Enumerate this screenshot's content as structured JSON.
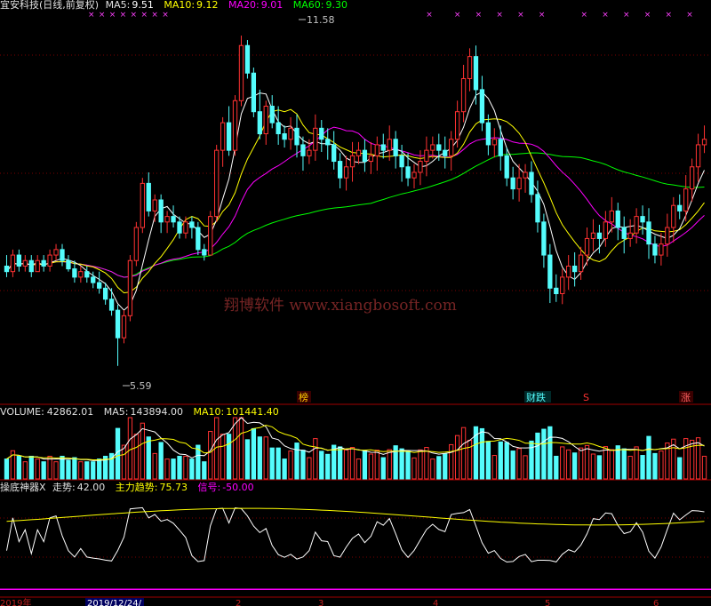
{
  "price_header": {
    "title": "宜安科技(日线,前复权)",
    "ma5_label": "MA5:",
    "ma5": "9.51",
    "ma10_label": "MA10:",
    "ma10": "9.12",
    "ma20_label": "MA20:",
    "ma20": "9.01",
    "ma60_label": "MA60:",
    "ma60": "9.30"
  },
  "volume_header": {
    "title": "VOLUME:",
    "volume": "42862.01",
    "ma5_label": "MA5:",
    "ma5": "143894.00",
    "ma10_label": "MA10:",
    "ma10": "101441.40"
  },
  "indicator_header": {
    "title": "操底神器X",
    "trend_label": "走势:",
    "trend": "42.00",
    "main_label": "主力趋势:",
    "main": "75.73",
    "signal_label": "信号:",
    "signal": "-50.00"
  },
  "price_annotations": {
    "high": "11.58",
    "low": "5.59"
  },
  "event_tags": {
    "bang": "榜",
    "caidie": "财跌",
    "s": "S",
    "zhang": "涨"
  },
  "watermark": "翔博软件 www.xiangbosoft.com",
  "axis": {
    "year_label": "2019年",
    "date_box": "2019/12/24/",
    "months": [
      "2",
      "3",
      "4",
      "5",
      "6"
    ]
  },
  "colors": {
    "up": "#ff3232",
    "down": "#54fcfc",
    "ma5": "#ffffff",
    "ma10": "#ffff00",
    "ma20": "#ff00ff",
    "ma60": "#00ff00",
    "grid": "#7a0000"
  },
  "chart_data": {
    "type": "candlestick",
    "title": "宜安科技(日线,前复权)",
    "ylim": [
      5.2,
      12.0
    ],
    "highest": 11.58,
    "lowest": 5.59,
    "ohlc": [
      [
        7.4,
        7.6,
        7.2,
        7.3
      ],
      [
        7.3,
        7.7,
        7.2,
        7.6
      ],
      [
        7.6,
        7.7,
        7.3,
        7.4
      ],
      [
        7.4,
        7.6,
        7.3,
        7.5
      ],
      [
        7.5,
        7.6,
        7.2,
        7.3
      ],
      [
        7.3,
        7.6,
        7.3,
        7.5
      ],
      [
        7.5,
        7.6,
        7.3,
        7.4
      ],
      [
        7.4,
        7.7,
        7.3,
        7.6
      ],
      [
        7.6,
        7.8,
        7.5,
        7.7
      ],
      [
        7.7,
        7.8,
        7.4,
        7.5
      ],
      [
        7.5,
        7.6,
        7.3,
        7.35
      ],
      [
        7.35,
        7.5,
        7.1,
        7.2
      ],
      [
        7.2,
        7.4,
        7.1,
        7.3
      ],
      [
        7.3,
        7.4,
        7.1,
        7.2
      ],
      [
        7.2,
        7.3,
        7.0,
        7.1
      ],
      [
        7.1,
        7.3,
        6.9,
        7.0
      ],
      [
        7.0,
        7.1,
        6.7,
        6.8
      ],
      [
        6.8,
        7.0,
        6.5,
        6.6
      ],
      [
        6.6,
        6.7,
        5.59,
        6.1
      ],
      [
        6.1,
        6.6,
        6.0,
        6.5
      ],
      [
        6.5,
        7.6,
        6.4,
        7.5
      ],
      [
        7.5,
        8.2,
        7.4,
        8.1
      ],
      [
        8.1,
        9.0,
        8.0,
        8.9
      ],
      [
        8.9,
        9.1,
        8.3,
        8.4
      ],
      [
        8.4,
        8.7,
        8.2,
        8.6
      ],
      [
        8.6,
        8.7,
        8.0,
        8.2
      ],
      [
        8.2,
        8.4,
        8.0,
        8.3
      ],
      [
        8.3,
        8.5,
        8.1,
        8.2
      ],
      [
        8.2,
        8.3,
        7.9,
        8.0
      ],
      [
        8.0,
        8.3,
        7.9,
        8.2
      ],
      [
        8.2,
        8.3,
        7.9,
        8.1
      ],
      [
        8.1,
        8.2,
        7.6,
        7.7
      ],
      [
        7.7,
        7.8,
        7.5,
        7.6
      ],
      [
        7.6,
        8.4,
        7.6,
        8.3
      ],
      [
        8.3,
        9.6,
        8.2,
        9.5
      ],
      [
        9.5,
        10.1,
        9.2,
        10.0
      ],
      [
        10.0,
        10.3,
        9.4,
        9.5
      ],
      [
        9.5,
        10.5,
        9.4,
        10.4
      ],
      [
        10.4,
        11.58,
        10.3,
        11.4
      ],
      [
        11.4,
        11.5,
        10.8,
        10.9
      ],
      [
        10.9,
        11.0,
        10.1,
        10.2
      ],
      [
        10.2,
        10.6,
        9.7,
        9.8
      ],
      [
        9.8,
        10.4,
        9.6,
        10.3
      ],
      [
        10.3,
        10.5,
        9.9,
        10.0
      ],
      [
        10.0,
        10.3,
        9.6,
        9.8
      ]
    ],
    "volume_ylim": [
      0,
      200000
    ],
    "volume_latest": 42862.01,
    "volume_ma5": 143894.0,
    "volume_ma10": 101441.4,
    "indicator_ylim": [
      -60,
      110
    ],
    "indicator_series": [
      {
        "name": "走势",
        "latest": 42.0
      },
      {
        "name": "主力趋势",
        "latest": 75.73
      },
      {
        "name": "信号",
        "latest": -50.0
      }
    ]
  }
}
